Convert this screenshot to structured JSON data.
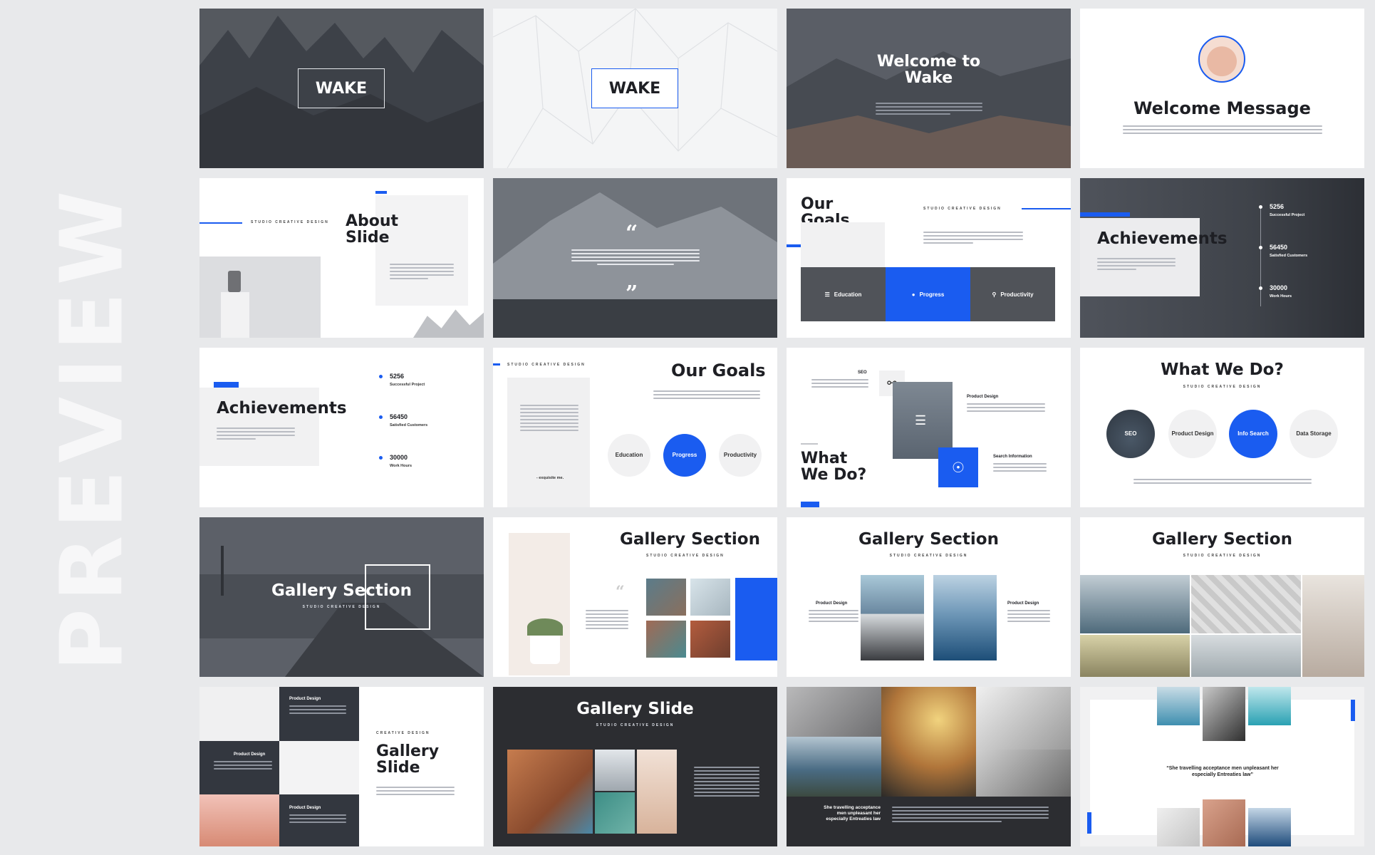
{
  "preview_label": "PREVIEW",
  "slides": {
    "s1": {
      "title": "WAKE"
    },
    "s2": {
      "title": "WAKE"
    },
    "s3": {
      "title_line1": "Welcome to",
      "title_line2": "Wake"
    },
    "s4": {
      "title": "Welcome Message"
    },
    "s5": {
      "title_line1": "About",
      "title_line2": "Slide",
      "subtitle": "STUDIO CREATIVE DESIGN"
    },
    "s6": {
      "open_quote": "“",
      "close_quote": "”"
    },
    "s7": {
      "title_line1": "Our",
      "title_line2": "Goals",
      "subtitle": "STUDIO CREATIVE DESIGN",
      "tiles": [
        "Education",
        "Progress",
        "Productivity"
      ]
    },
    "s8": {
      "title": "Achievements",
      "stats": [
        {
          "num": "5256",
          "label": "Successful Project"
        },
        {
          "num": "56450",
          "label": "Satisfied Customers"
        },
        {
          "num": "30000",
          "label": "Work Hours"
        }
      ]
    },
    "s9": {
      "title": "Achievements",
      "stats": [
        {
          "num": "5256",
          "label": "Successful Project"
        },
        {
          "num": "56450",
          "label": "Satisfied Customers"
        },
        {
          "num": "30000",
          "label": "Work Hours"
        }
      ]
    },
    "s10": {
      "title": "Our Goals",
      "subtitle": "STUDIO CREATIVE DESIGN",
      "signature": "- exquisite me.",
      "circles": [
        "Education",
        "Progress",
        "Productivity"
      ]
    },
    "s11": {
      "title_line1": "What",
      "title_line2": "We Do?",
      "labels": [
        "SEO",
        "Product Design",
        "Search Information"
      ]
    },
    "s12": {
      "title": "What We Do?",
      "subtitle": "STUDIO CREATIVE DESIGN",
      "circles": [
        "SEO",
        "Product Design",
        "Info Search",
        "Data Storage"
      ]
    },
    "s13": {
      "title": "Gallery Section",
      "subtitle": "STUDIO CREATIVE DESIGN"
    },
    "s14": {
      "title": "Gallery Section",
      "subtitle": "STUDIO CREATIVE DESIGN"
    },
    "s15": {
      "title": "Gallery Section",
      "subtitle": "STUDIO CREATIVE DESIGN",
      "labels": [
        "Product Design",
        "Product Design"
      ]
    },
    "s16": {
      "title": "Gallery Section",
      "subtitle": "STUDIO CREATIVE DESIGN"
    },
    "s17": {
      "title_line1": "Gallery",
      "title_line2": "Slide",
      "subtitle": "CREATIVE DESIGN",
      "labels": [
        "Product Design",
        "Product Design",
        "Product Design"
      ]
    },
    "s18": {
      "title": "Gallery Slide",
      "subtitle": "STUDIO CREATIVE DESIGN"
    },
    "s19": {
      "caption": "She travelling acceptance men unpleasant her especially Entreaties law"
    },
    "s20": {
      "quote": "“She travelling acceptance men unpleasant her especially Entreaties law”"
    }
  }
}
